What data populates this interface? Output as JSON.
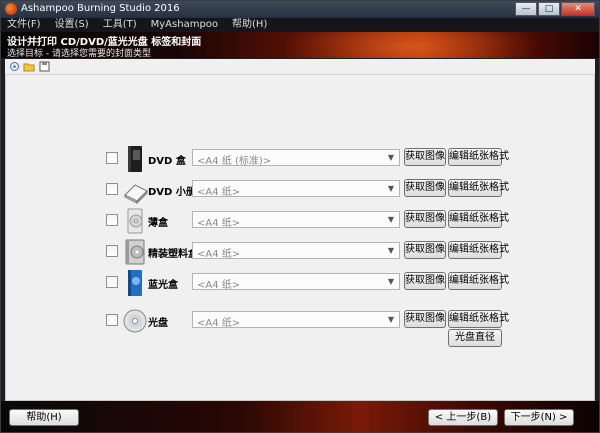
{
  "window": {
    "title": "Ashampoo Burning Studio 2016"
  },
  "window_buttons": {
    "minimize": "—",
    "maximize": "□",
    "close": "✕"
  },
  "menu": [
    "文件(F)",
    "设置(S)",
    "工具(T)",
    "MyAshampoo",
    "帮助(H)"
  ],
  "banner": {
    "title": "设计并打印 CD/DVD/蓝光光盘 标签和封面",
    "subtitle": "选择目标 - 请选择您需要的封面类型"
  },
  "toolbar": {
    "icons": [
      "new-icon",
      "open-folder-icon",
      "save-icon"
    ]
  },
  "rows": [
    {
      "label": "DVD 盒",
      "combo": "<A4 纸 (标准)>",
      "get_image": "获取图像",
      "edit_paper": "编辑纸张格式",
      "icon": "dvd-case-icon"
    },
    {
      "label": "DVD 小册子",
      "combo": "<A4 纸>",
      "get_image": "获取图像",
      "edit_paper": "编辑纸张格式",
      "icon": "dvd-booklet-icon"
    },
    {
      "label": "薄盒",
      "combo": "<A4 纸>",
      "get_image": "获取图像",
      "edit_paper": "编辑纸张格式",
      "icon": "slim-case-icon"
    },
    {
      "label": "精装塑料盒",
      "combo": "<A4 纸>",
      "get_image": "获取图像",
      "edit_paper": "编辑纸张格式",
      "icon": "jewel-case-icon"
    },
    {
      "label": "蓝光盒",
      "combo": "<A4 纸>",
      "get_image": "获取图像",
      "edit_paper": "编辑纸张格式",
      "icon": "bluray-case-icon"
    },
    {
      "label": "光盘",
      "combo": "<A4 纸>",
      "get_image": "获取图像",
      "edit_paper": "编辑纸张格式",
      "icon": "disc-icon"
    }
  ],
  "disc_radius_button": "光盘直径",
  "footer": {
    "help": "帮助(H)",
    "prev": "< 上一步(B)",
    "next": "下一步(N) >"
  }
}
